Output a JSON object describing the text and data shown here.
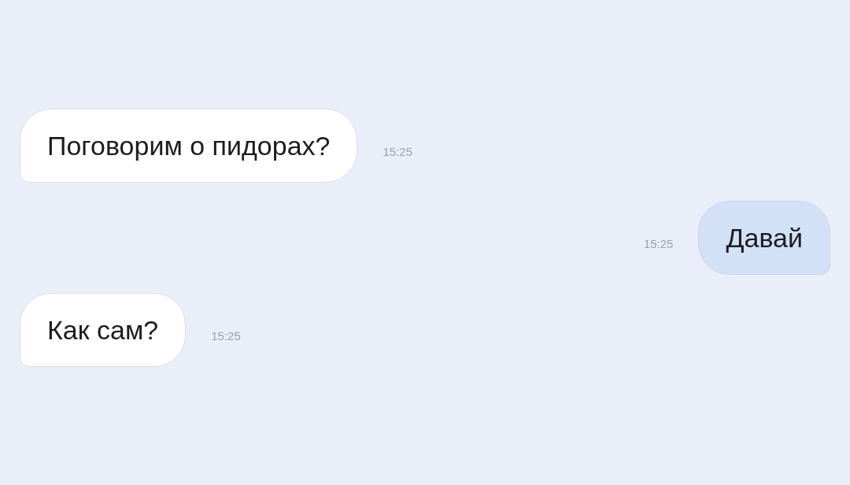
{
  "messages": [
    {
      "kind": "incoming",
      "text": "Поговорим о пидорах?",
      "time": "15:25"
    },
    {
      "kind": "outgoing",
      "text": "Давай",
      "time": "15:25"
    },
    {
      "kind": "incoming",
      "text": "Как сам?",
      "time": "15:25"
    }
  ]
}
